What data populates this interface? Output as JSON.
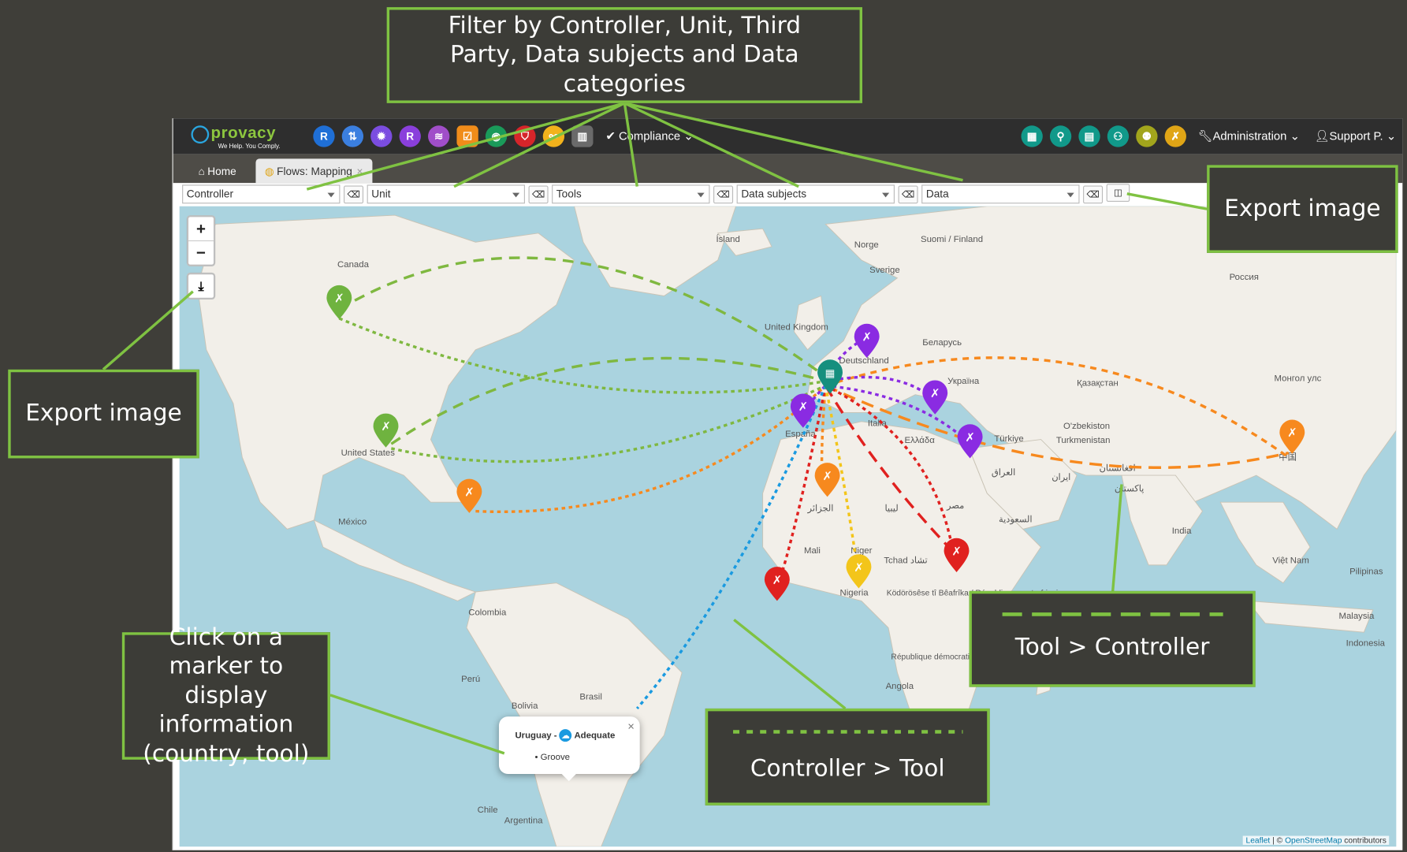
{
  "app": {
    "logo_name": "provacy",
    "logo_tagline": "We Help. You Comply.",
    "nav_left_badges": [
      {
        "label": "R",
        "color": "#1f6fd6"
      },
      {
        "label": "",
        "color": "#3b7fe0",
        "icon": "flow-icon"
      },
      {
        "label": "",
        "color": "#7b4de0",
        "icon": "gear-icon"
      },
      {
        "label": "R",
        "color": "#8a3fdc",
        "icon": "r-icon"
      },
      {
        "label": "",
        "color": "#a04ec9",
        "icon": "waves-icon"
      },
      {
        "label": "",
        "color": "#f08c1a",
        "icon": "checklist-icon"
      },
      {
        "label": "",
        "color": "#1a9a5a",
        "icon": "user-icon"
      },
      {
        "label": "",
        "color": "#d6252a",
        "icon": "shield-icon"
      },
      {
        "label": "",
        "color": "#f2b21c",
        "icon": "share-icon"
      },
      {
        "label": "",
        "color": "#6a6a6a",
        "icon": "books-icon"
      }
    ],
    "compliance_label": "Compliance",
    "nav_right_badges": [
      {
        "color": "#11998a",
        "icon": "building-icon"
      },
      {
        "color": "#11998a",
        "icon": "org-chart-icon"
      },
      {
        "color": "#11998a",
        "icon": "buildings-icon"
      },
      {
        "color": "#11998a",
        "icon": "users-icon"
      },
      {
        "color": "#a2a51c",
        "icon": "people-icon"
      },
      {
        "color": "#e0a516",
        "icon": "tools-icon"
      }
    ],
    "administration_label": "Administration",
    "user_label": "Support P."
  },
  "tabs": {
    "home": "Home",
    "active": "Flows: Mapping"
  },
  "filters": {
    "controller": "Controller",
    "unit": "Unit",
    "tools": "Tools",
    "data_subjects": "Data subjects",
    "data": "Data"
  },
  "map": {
    "zoom_in": "+",
    "zoom_out": "−",
    "download": "⤓",
    "labels": {
      "canada": "Canada",
      "iceland": "Ísland",
      "norway": "Norge",
      "finland": "Suomi / Finland",
      "sweden": "Sverige",
      "russia": "Россия",
      "uk": "United Kingdom",
      "germany": "Deutschland",
      "belarus": "Беларусь",
      "ukraine": "Україна",
      "kazakhstan": "Қазақстан",
      "mongolia": "Монгол улс",
      "usa": "United States",
      "mexico": "México",
      "spain": "España",
      "italy": "Italia",
      "turkey": "Türkiye",
      "uzbekistan": "O'zbekiston",
      "turkmenistan": "Turkmenistan",
      "greece": "Ελλάδα",
      "algeria": "الجزائر",
      "iraq": "العراق",
      "iran": "ایران",
      "afghanistan": "افغانستان",
      "pakistan": "پاکستان",
      "china": "中国",
      "egypt": "مصر",
      "libya": "ليبيا",
      "saudi": "السعودية",
      "india": "India",
      "mali": "Mali",
      "niger": "Niger",
      "nigeria": "Nigeria",
      "chad": "Tchad تشاد",
      "car": "Ködörösêse tî Bêafrîka / République centrafricaine",
      "drc": "République démocratique du Congo",
      "angola": "Angola",
      "colombia": "Colombia",
      "peru": "Perú",
      "bolivia": "Bolivia",
      "brasil": "Brasil",
      "chile": "Chile",
      "argentina": "Argentina",
      "vietnam": "Việt Nam",
      "malaysia": "Malaysia",
      "indonesia": "Indonesia",
      "philippines": "Pilipinas"
    },
    "popup": {
      "country": "Uruguay",
      "separator": "-",
      "status": "Adequate",
      "tool": "Groove",
      "close": "×"
    },
    "attribution": {
      "leaflet": "Leaflet",
      "sep": "| ©",
      "osm": "OpenStreetMap",
      "contributors": "contributors"
    }
  },
  "callouts": {
    "filter": "Filter by Controller, Unit, Third Party, Data subjects and Data categories",
    "export_top": "Export image",
    "export_left": "Export image",
    "marker_info": "Click on a marker to display information (country, tool)",
    "tool_controller": "Tool > Controller",
    "controller_tool": "Controller > Tool"
  },
  "colors": {
    "callout_border": "#7fc242",
    "green_marker": "#6fb33f",
    "purple_marker": "#8a2be2",
    "orange_marker": "#f7891e",
    "red_marker": "#e0211f",
    "yellow_marker": "#f3c51a",
    "teal_controller": "#168f7e",
    "blue_flow": "#1a9ae0"
  }
}
